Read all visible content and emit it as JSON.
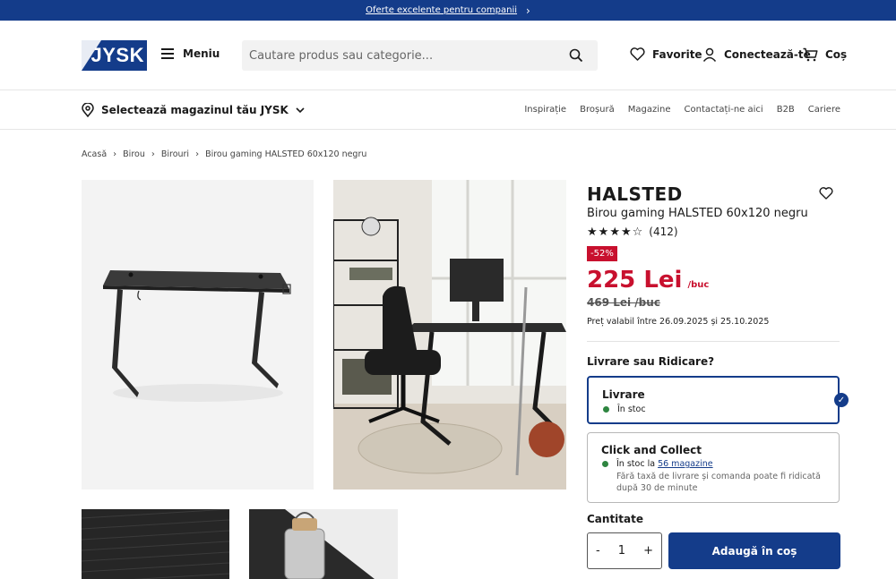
{
  "topbar": {
    "promo_text": "Oferte excelente pentru companii"
  },
  "header": {
    "logo_text": "JYSK",
    "menu_label": "Meniu",
    "search_placeholder": "Cautare produs sau categorie...",
    "favorites_label": "Favorite",
    "login_label": "Conectează-te",
    "cart_label": "Coș"
  },
  "storebar": {
    "store_select_label": "Selectează magazinul tău JYSK",
    "links": [
      "Inspirație",
      "Broșură",
      "Magazine",
      "Contactați-ne aici",
      "B2B",
      "Cariere"
    ]
  },
  "breadcrumb": [
    "Acasă",
    "Birou",
    "Birouri",
    "Birou gaming HALSTED 60x120 negru"
  ],
  "product": {
    "name": "HALSTED",
    "subtitle": "Birou gaming HALSTED 60x120 negru",
    "rating": 4.5,
    "review_count": "(412)",
    "discount_badge": "-52%",
    "price": "225 Lei",
    "price_unit": "/buc",
    "old_price": "469 Lei /buc",
    "validity": "Preț valabil între 26.09.2025 și 25.10.2025"
  },
  "delivery": {
    "question": "Livrare sau Ridicare?",
    "option1": {
      "title": "Livrare",
      "stock": "În stoc",
      "selected": true
    },
    "option2": {
      "title": "Click and Collect",
      "stock_prefix": "În stoc la",
      "stock_link": "56 magazine",
      "note": "Fără taxă de livrare și comanda poate fi ridicată după 30 de minute"
    }
  },
  "quantity": {
    "label": "Cantitate",
    "minus": "-",
    "value": "1",
    "plus": "+"
  },
  "cart_button": "Adaugă în coș",
  "colors": {
    "brand_blue": "#143c8a",
    "sale_red": "#c8102e",
    "stock_green": "#2e8540"
  },
  "icons": {
    "search": "search-icon",
    "heart": "heart-icon",
    "user": "user-icon",
    "cart": "cart-icon",
    "pin": "location-pin-icon",
    "chevron": "chevron-down-icon",
    "check": "check-icon",
    "star": "star-icon"
  }
}
